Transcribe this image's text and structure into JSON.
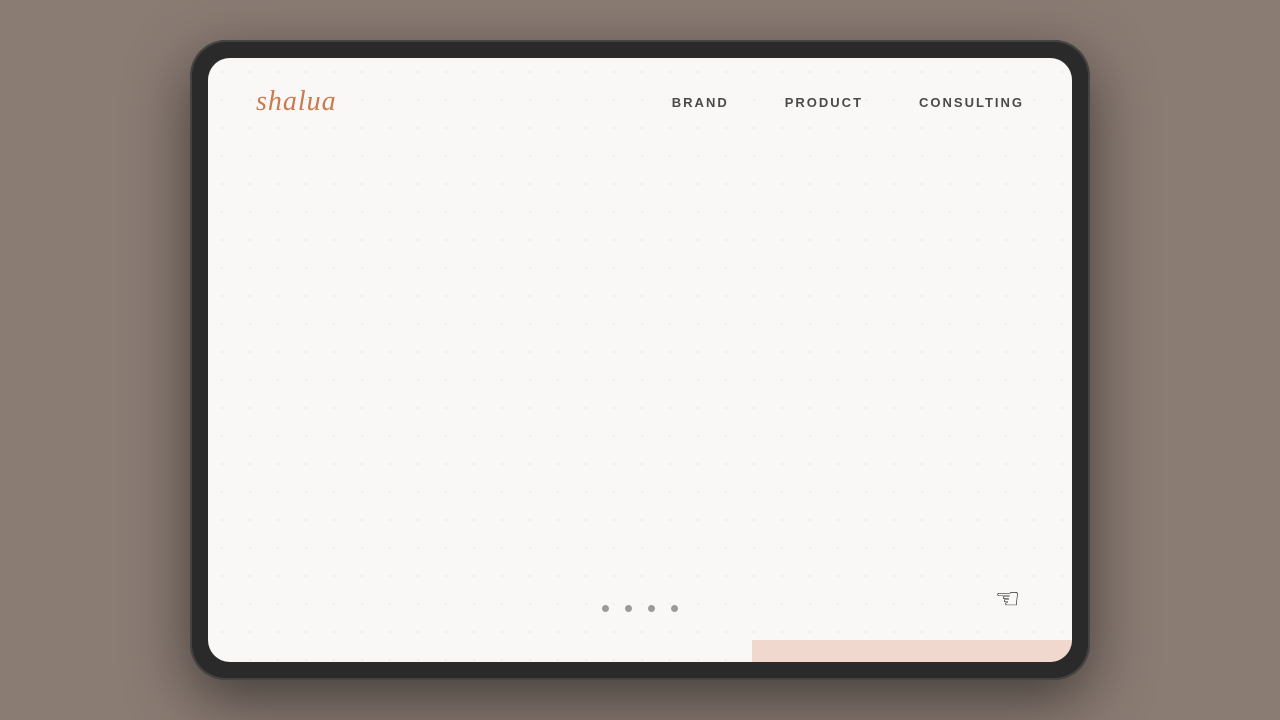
{
  "logo": {
    "text": "shalua"
  },
  "nav": {
    "items": [
      {
        "label": "BRAND",
        "id": "brand"
      },
      {
        "label": "PRODUCT",
        "id": "product"
      },
      {
        "label": "CONSULTING",
        "id": "consulting"
      }
    ]
  },
  "pagination": {
    "dots": [
      {
        "active": false
      },
      {
        "active": false
      },
      {
        "active": false
      },
      {
        "active": false
      }
    ]
  },
  "colors": {
    "logo": "#c97a4e",
    "background": "#faf8f6",
    "frame": "#2a2a2a",
    "outer": "#8a7b73"
  }
}
